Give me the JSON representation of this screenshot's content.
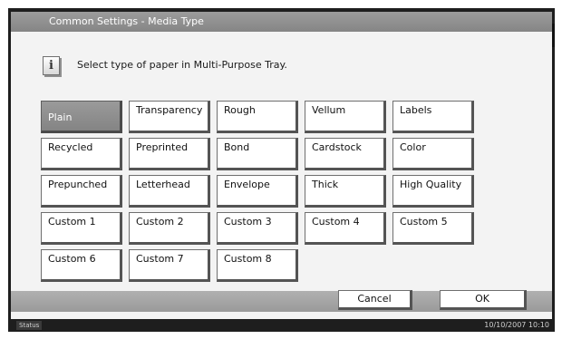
{
  "title": "Common Settings - Media Type",
  "message": "Select type of paper in Multi-Purpose Tray.",
  "media_types": [
    [
      "Plain",
      "Transparency",
      "Rough",
      "Vellum",
      "Labels"
    ],
    [
      "Recycled",
      "Preprinted",
      "Bond",
      "Cardstock",
      "Color"
    ],
    [
      "Prepunched",
      "Letterhead",
      "Envelope",
      "Thick",
      "High Quality"
    ],
    [
      "Custom 1",
      "Custom 2",
      "Custom 3",
      "Custom 4",
      "Custom 5"
    ],
    [
      "Custom 6",
      "Custom 7",
      "Custom 8"
    ]
  ],
  "selected": "Plain",
  "buttons": {
    "cancel": "Cancel",
    "ok": "OK"
  },
  "status": {
    "label": "Status",
    "datetime": "10/10/2007  10:10"
  },
  "icons": {
    "info": "info-icon"
  }
}
